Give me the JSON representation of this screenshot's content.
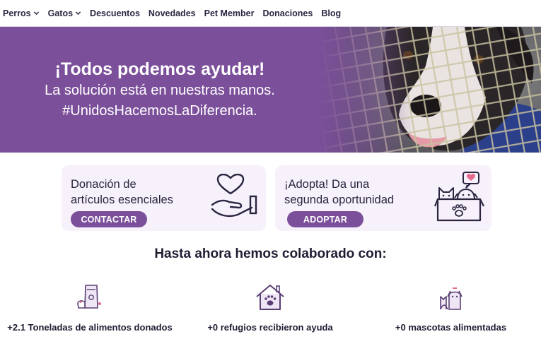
{
  "nav": {
    "items": [
      {
        "label": "Perros",
        "dropdown": true
      },
      {
        "label": "Gatos",
        "dropdown": true
      },
      {
        "label": "Descuentos",
        "dropdown": false
      },
      {
        "label": "Novedades",
        "dropdown": false
      },
      {
        "label": "Pet Member",
        "dropdown": false
      },
      {
        "label": "Donaciones",
        "dropdown": false
      },
      {
        "label": "Blog",
        "dropdown": false
      }
    ]
  },
  "hero": {
    "title": "¡Todos podemos ayudar!",
    "line1": "La solución está en nuestras manos.",
    "line2": "#UnidosHacemosLaDiferencia.",
    "image": "dog-behind-fence-photo"
  },
  "cards": [
    {
      "text_line1": "Donación de",
      "text_line2": "artículos esenciales",
      "button": "CONTACTAR",
      "icon": "heart-hand-icon"
    },
    {
      "text_line1": "¡Adopta! Da una",
      "text_line2": "segunda oportunidad",
      "button": "ADOPTAR",
      "icon": "pets-in-box-icon"
    }
  ],
  "stats": {
    "title": "Hasta ahora hemos colaborado con:",
    "items": [
      {
        "label": "+2.1 Toneladas de alimentos donados",
        "icon": "pet-food-icon"
      },
      {
        "label": "+0 refugios recibieron ayuda",
        "icon": "paw-house-icon"
      },
      {
        "label": "+0 mascotas alimentadas",
        "icon": "cat-dog-icon"
      }
    ]
  },
  "colors": {
    "brand_purple": "#7b4f9a",
    "card_background": "#f6f1fa",
    "text_dark": "#221c33"
  }
}
